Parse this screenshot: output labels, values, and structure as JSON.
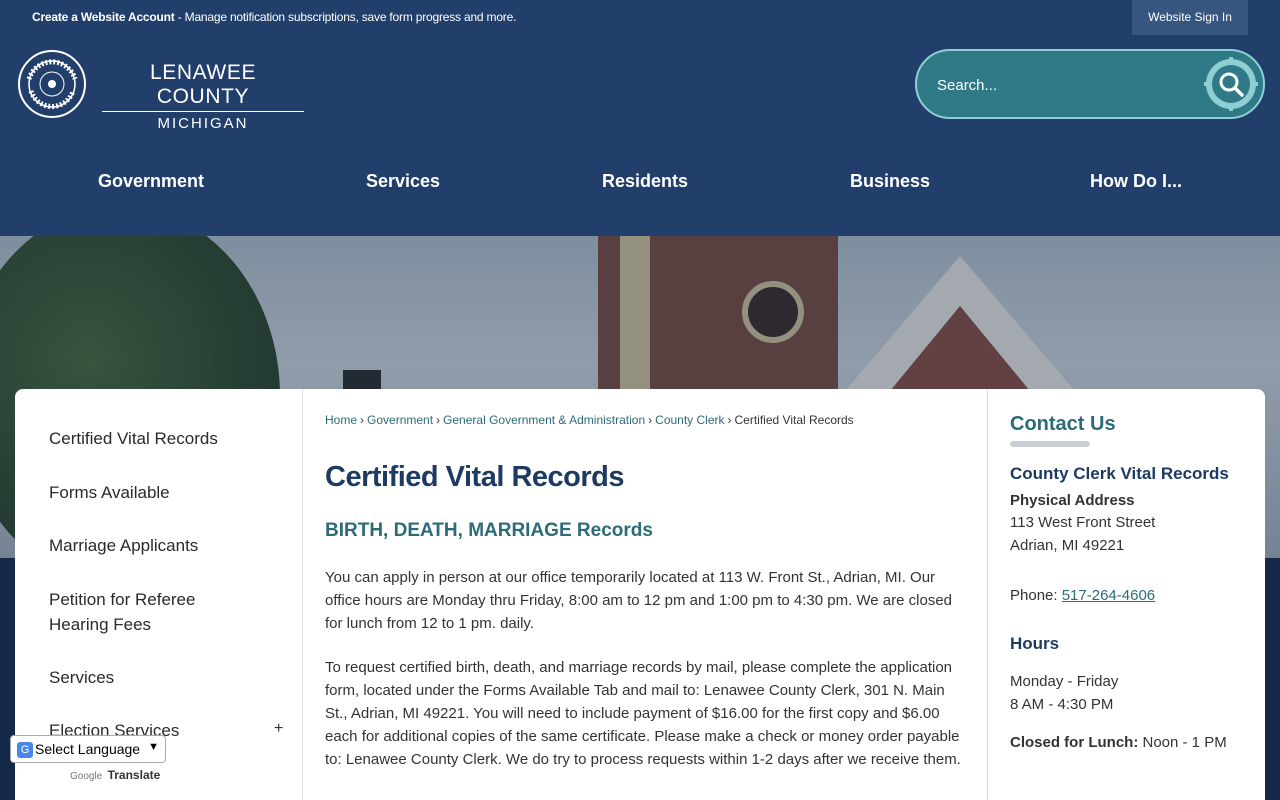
{
  "topbar": {
    "account_strong": "Create a Website Account",
    "account_rest": " - Manage notification subscriptions, save form progress and more.",
    "signin_label": "Website Sign In"
  },
  "logo": {
    "county": "LENAWEE COUNTY",
    "state": "MICHIGAN",
    "seal_top": "LENAWEE COUNTY",
    "seal_bottom": "MICHIGAN"
  },
  "search": {
    "placeholder": "Search..."
  },
  "nav": [
    "Government",
    "Services",
    "Residents",
    "Business",
    "How Do I..."
  ],
  "sidebar": {
    "items": [
      "Certified Vital Records",
      "Forms Available",
      "Marriage Applicants",
      "Petition for Referee Hearing Fees",
      "Services",
      "Election Services"
    ],
    "expand_symbol": "+"
  },
  "breadcrumb": {
    "links": [
      "Home",
      "Government",
      "General Government & Administration",
      "County Clerk"
    ],
    "current": "Certified Vital Records"
  },
  "main": {
    "title": "Certified Vital Records",
    "subhead": "BIRTH, DEATH, MARRIAGE Records",
    "para1": "You can apply in person at our office temporarily located at 113 W. Front St., Adrian, MI.  Our office hours are Monday thru Friday, 8:00 am to 12 pm and 1:00 pm to 4:30 pm.  We are closed for lunch from 12 to 1 pm. daily.",
    "para2": "To request certified birth, death, and marriage records by mail, please complete the application form, located under the Forms Available Tab and mail to: Lenawee County Clerk, 301 N. Main St., Adrian, MI  49221.  You will need to include payment of $16.00 for the first copy and $6.00 each for additional copies of the same certificate.  Please make a check or money order payable to: Lenawee County Clerk.  We do try to process requests within 1-2 days after we receive them."
  },
  "contact": {
    "title": "Contact Us",
    "dept": "County Clerk Vital Records",
    "address_label": "Physical Address",
    "address1": "113 West Front Street",
    "address2": "Adrian, MI 49221",
    "phone_label": "Phone: ",
    "phone": "517-264-4606",
    "hours_title": "Hours",
    "hours_days": "Monday - Friday",
    "hours_time": "8 AM - 4:30 PM",
    "lunch_label": "Closed for Lunch:",
    "lunch_time": " Noon - 1 PM"
  },
  "translate": {
    "select_label": "Select Language",
    "google": "Google",
    "translate": "Translate"
  },
  "colors": {
    "header": "#223f6b",
    "topbar": "#213f6a",
    "search_fill": "#2f7a86",
    "accent_teal": "#2c6b78",
    "title_navy": "#1d3a62"
  }
}
